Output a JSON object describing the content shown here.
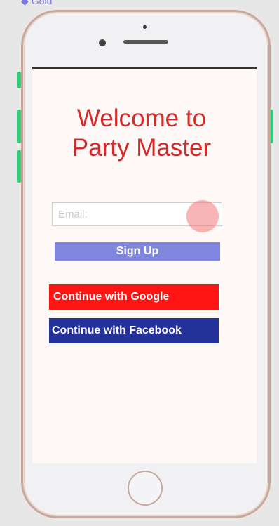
{
  "top_label": {
    "text": "Gold"
  },
  "screen": {
    "welcome_line1": "Welcome to",
    "welcome_line2": "Party Master",
    "email_placeholder": "Email:",
    "signup_label": "Sign Up",
    "google_label": "Continue with Google",
    "facebook_label": "Continue with Facebook"
  },
  "colors": {
    "welcome_text": "#d42a2a",
    "signup_bg": "#7f86dd",
    "google_bg": "#ff1414",
    "facebook_bg": "#25319a",
    "frame": "#c9a89b",
    "side_buttons": "#2ecf78"
  },
  "icons": {
    "camera": "camera-icon",
    "speaker": "speaker-icon",
    "home": "home-button-icon"
  }
}
